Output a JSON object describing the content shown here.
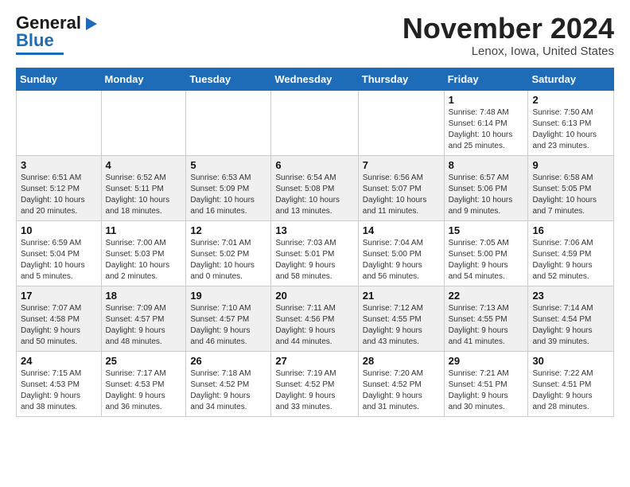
{
  "logo": {
    "line1": "General",
    "line2": "Blue"
  },
  "title": "November 2024",
  "location": "Lenox, Iowa, United States",
  "days_of_week": [
    "Sunday",
    "Monday",
    "Tuesday",
    "Wednesday",
    "Thursday",
    "Friday",
    "Saturday"
  ],
  "weeks": [
    [
      {
        "day": "",
        "info": ""
      },
      {
        "day": "",
        "info": ""
      },
      {
        "day": "",
        "info": ""
      },
      {
        "day": "",
        "info": ""
      },
      {
        "day": "",
        "info": ""
      },
      {
        "day": "1",
        "info": "Sunrise: 7:48 AM\nSunset: 6:14 PM\nDaylight: 10 hours\nand 25 minutes."
      },
      {
        "day": "2",
        "info": "Sunrise: 7:50 AM\nSunset: 6:13 PM\nDaylight: 10 hours\nand 23 minutes."
      }
    ],
    [
      {
        "day": "3",
        "info": "Sunrise: 6:51 AM\nSunset: 5:12 PM\nDaylight: 10 hours\nand 20 minutes."
      },
      {
        "day": "4",
        "info": "Sunrise: 6:52 AM\nSunset: 5:11 PM\nDaylight: 10 hours\nand 18 minutes."
      },
      {
        "day": "5",
        "info": "Sunrise: 6:53 AM\nSunset: 5:09 PM\nDaylight: 10 hours\nand 16 minutes."
      },
      {
        "day": "6",
        "info": "Sunrise: 6:54 AM\nSunset: 5:08 PM\nDaylight: 10 hours\nand 13 minutes."
      },
      {
        "day": "7",
        "info": "Sunrise: 6:56 AM\nSunset: 5:07 PM\nDaylight: 10 hours\nand 11 minutes."
      },
      {
        "day": "8",
        "info": "Sunrise: 6:57 AM\nSunset: 5:06 PM\nDaylight: 10 hours\nand 9 minutes."
      },
      {
        "day": "9",
        "info": "Sunrise: 6:58 AM\nSunset: 5:05 PM\nDaylight: 10 hours\nand 7 minutes."
      }
    ],
    [
      {
        "day": "10",
        "info": "Sunrise: 6:59 AM\nSunset: 5:04 PM\nDaylight: 10 hours\nand 5 minutes."
      },
      {
        "day": "11",
        "info": "Sunrise: 7:00 AM\nSunset: 5:03 PM\nDaylight: 10 hours\nand 2 minutes."
      },
      {
        "day": "12",
        "info": "Sunrise: 7:01 AM\nSunset: 5:02 PM\nDaylight: 10 hours\nand 0 minutes."
      },
      {
        "day": "13",
        "info": "Sunrise: 7:03 AM\nSunset: 5:01 PM\nDaylight: 9 hours\nand 58 minutes."
      },
      {
        "day": "14",
        "info": "Sunrise: 7:04 AM\nSunset: 5:00 PM\nDaylight: 9 hours\nand 56 minutes."
      },
      {
        "day": "15",
        "info": "Sunrise: 7:05 AM\nSunset: 5:00 PM\nDaylight: 9 hours\nand 54 minutes."
      },
      {
        "day": "16",
        "info": "Sunrise: 7:06 AM\nSunset: 4:59 PM\nDaylight: 9 hours\nand 52 minutes."
      }
    ],
    [
      {
        "day": "17",
        "info": "Sunrise: 7:07 AM\nSunset: 4:58 PM\nDaylight: 9 hours\nand 50 minutes."
      },
      {
        "day": "18",
        "info": "Sunrise: 7:09 AM\nSunset: 4:57 PM\nDaylight: 9 hours\nand 48 minutes."
      },
      {
        "day": "19",
        "info": "Sunrise: 7:10 AM\nSunset: 4:57 PM\nDaylight: 9 hours\nand 46 minutes."
      },
      {
        "day": "20",
        "info": "Sunrise: 7:11 AM\nSunset: 4:56 PM\nDaylight: 9 hours\nand 44 minutes."
      },
      {
        "day": "21",
        "info": "Sunrise: 7:12 AM\nSunset: 4:55 PM\nDaylight: 9 hours\nand 43 minutes."
      },
      {
        "day": "22",
        "info": "Sunrise: 7:13 AM\nSunset: 4:55 PM\nDaylight: 9 hours\nand 41 minutes."
      },
      {
        "day": "23",
        "info": "Sunrise: 7:14 AM\nSunset: 4:54 PM\nDaylight: 9 hours\nand 39 minutes."
      }
    ],
    [
      {
        "day": "24",
        "info": "Sunrise: 7:15 AM\nSunset: 4:53 PM\nDaylight: 9 hours\nand 38 minutes."
      },
      {
        "day": "25",
        "info": "Sunrise: 7:17 AM\nSunset: 4:53 PM\nDaylight: 9 hours\nand 36 minutes."
      },
      {
        "day": "26",
        "info": "Sunrise: 7:18 AM\nSunset: 4:52 PM\nDaylight: 9 hours\nand 34 minutes."
      },
      {
        "day": "27",
        "info": "Sunrise: 7:19 AM\nSunset: 4:52 PM\nDaylight: 9 hours\nand 33 minutes."
      },
      {
        "day": "28",
        "info": "Sunrise: 7:20 AM\nSunset: 4:52 PM\nDaylight: 9 hours\nand 31 minutes."
      },
      {
        "day": "29",
        "info": "Sunrise: 7:21 AM\nSunset: 4:51 PM\nDaylight: 9 hours\nand 30 minutes."
      },
      {
        "day": "30",
        "info": "Sunrise: 7:22 AM\nSunset: 4:51 PM\nDaylight: 9 hours\nand 28 minutes."
      }
    ]
  ]
}
